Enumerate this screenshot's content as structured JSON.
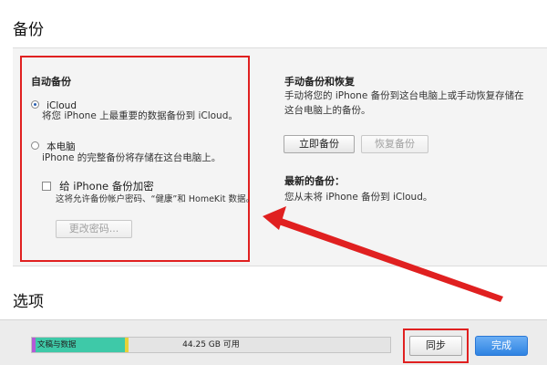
{
  "sections": {
    "backup_title": "备份",
    "options_title": "选项"
  },
  "auto_backup": {
    "heading": "自动备份",
    "icloud_label": "iCloud",
    "icloud_desc": "将您 iPhone 上最重要的数据备份到 iCloud。",
    "computer_label": "本电脑",
    "computer_desc": "iPhone 的完整备份将存储在这台电脑上。",
    "encrypt_label": "给 iPhone 备份加密",
    "encrypt_desc": "这将允许备份帐户密码、“健康”和 HomeKit 数据。",
    "change_password_label": "更改密码..."
  },
  "manual_backup": {
    "heading": "手动备份和恢复",
    "desc_line1": "手动将您的 iPhone 备份到这台电脑上或手动恢复存储在",
    "desc_line2": "这台电脑上的备份。",
    "backup_now_label": "立即备份",
    "restore_label": "恢复备份",
    "latest_heading": "最新的备份：",
    "latest_desc": "您从未将 iPhone 备份到 iCloud。"
  },
  "storage": {
    "apps_label": "文稿与数据",
    "free_label": "44.25 GB 可用",
    "used_fraction": 0.27,
    "colors": {
      "purple": "#b35ad6",
      "teal": "#3ec9a8",
      "yellow": "#e8d23a",
      "empty": "#e4e4e4"
    }
  },
  "footer": {
    "sync_label": "同步",
    "done_label": "完成"
  },
  "colors": {
    "annotation_red": "#e02020",
    "accent_blue": "#2e83e2"
  }
}
